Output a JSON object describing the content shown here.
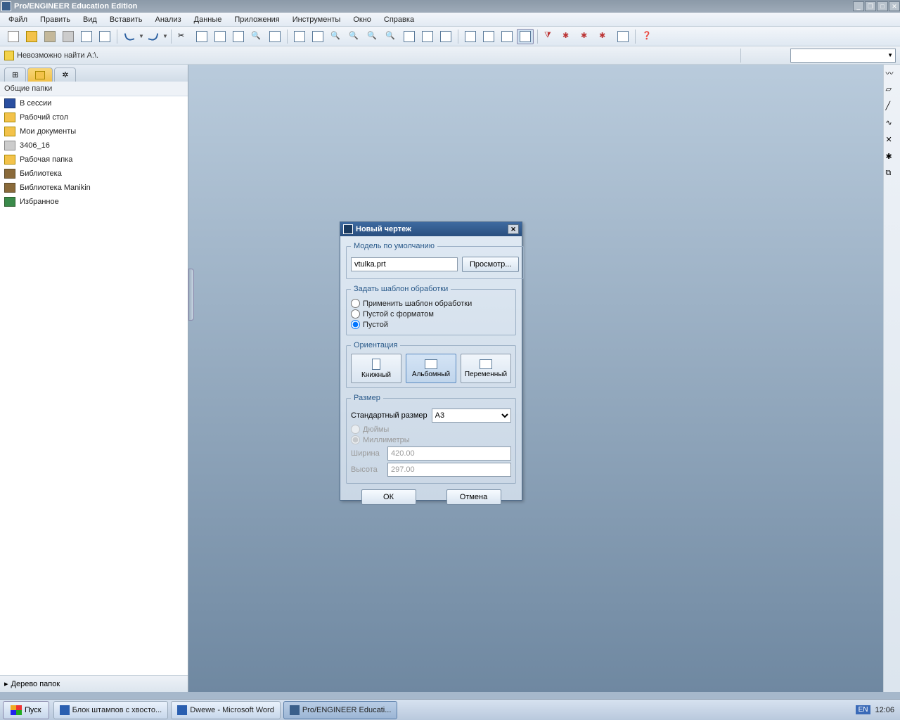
{
  "window": {
    "title": "Pro/ENGINEER Education Edition"
  },
  "menu": [
    "Файл",
    "Править",
    "Вид",
    "Вставить",
    "Анализ",
    "Данные",
    "Приложения",
    "Инструменты",
    "Окно",
    "Справка"
  ],
  "message": "Невозможно найти A:\\.",
  "sidebar": {
    "header": "Общие папки",
    "items": [
      {
        "label": "В сессии"
      },
      {
        "label": "Рабочий стол"
      },
      {
        "label": "Мои документы"
      },
      {
        "label": "3406_16"
      },
      {
        "label": "Рабочая папка"
      },
      {
        "label": "Библиотека"
      },
      {
        "label": "Библиотека Manikin"
      },
      {
        "label": "Избранное"
      }
    ],
    "treebar": "Дерево папок"
  },
  "dialog": {
    "title": "Новый чертеж",
    "model_section": "Модель по умолчанию",
    "model_value": "vtulka.prt",
    "browse": "Просмотр...",
    "template_section": "Задать шаблон обработки",
    "radio_tpl": "Применить шаблон обработки",
    "radio_empty_fmt": "Пустой с форматом",
    "radio_empty": "Пустой",
    "orient_section": "Ориентация",
    "orient_portrait": "Книжный",
    "orient_landscape": "Альбомный",
    "orient_variable": "Переменный",
    "size_section": "Размер",
    "std_size_label": "Стандартный размер",
    "std_size_value": "A3",
    "inches": "Дюймы",
    "mm": "Миллиметры",
    "width_label": "Ширина",
    "width_value": "420.00",
    "height_label": "Высота",
    "height_value": "297.00",
    "ok": "ОК",
    "cancel": "Отмена"
  },
  "taskbar": {
    "start": "Пуск",
    "items": [
      {
        "label": "Блок штампов с хвосто...",
        "active": false
      },
      {
        "label": "Dwewe - Microsoft Word",
        "active": false
      },
      {
        "label": "Pro/ENGINEER Educati...",
        "active": true
      }
    ],
    "lang": "EN",
    "clock": "12:06"
  }
}
